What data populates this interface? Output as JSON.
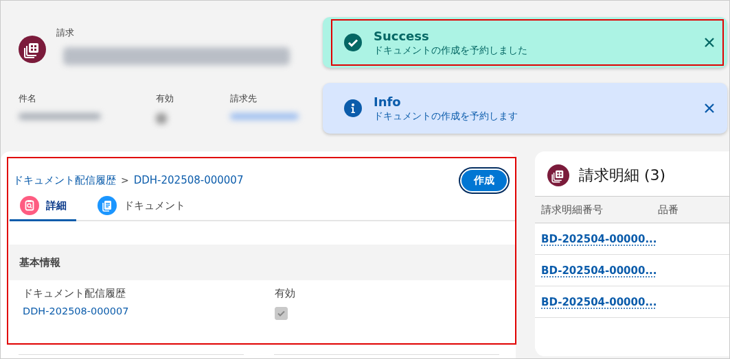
{
  "record_header": {
    "object_label": "請求",
    "fields": [
      {
        "label": "件名",
        "kind": "text"
      },
      {
        "label": "有効",
        "kind": "checkbox"
      },
      {
        "label": "請求先",
        "kind": "link"
      }
    ]
  },
  "toasts": [
    {
      "kind": "success",
      "title": "Success",
      "message": "ドキュメントの作成を予約しました",
      "highlighted": true
    },
    {
      "kind": "info",
      "title": "Info",
      "message": "ドキュメントの作成を予約します",
      "highlighted": false
    }
  ],
  "detail_card": {
    "highlighted": true,
    "breadcrumb": [
      {
        "kind": "link",
        "text": "ドキュメント配信履歴"
      },
      {
        "kind": "separator",
        "text": ">"
      },
      {
        "kind": "link",
        "text": "DDH-202508-000007"
      }
    ],
    "create_button": "作成",
    "tabs": [
      {
        "label": "詳細",
        "selected": true
      },
      {
        "label": "ドキュメント",
        "selected": false
      }
    ],
    "section_title": "基本情報",
    "fields": [
      {
        "kind": "link",
        "label": "ドキュメント配信履歴",
        "value": "DDH-202508-000007"
      },
      {
        "kind": "checkbox",
        "label": "有効",
        "checked": true,
        "disabled": true
      }
    ]
  },
  "related_list": {
    "title": "請求明細 (3)",
    "columns": [
      "請求明細番号",
      "品番"
    ],
    "rows": [
      {
        "number": "BD-202504-00000..."
      },
      {
        "number": "BD-202504-00000..."
      },
      {
        "number": "BD-202504-00000..."
      }
    ]
  }
}
